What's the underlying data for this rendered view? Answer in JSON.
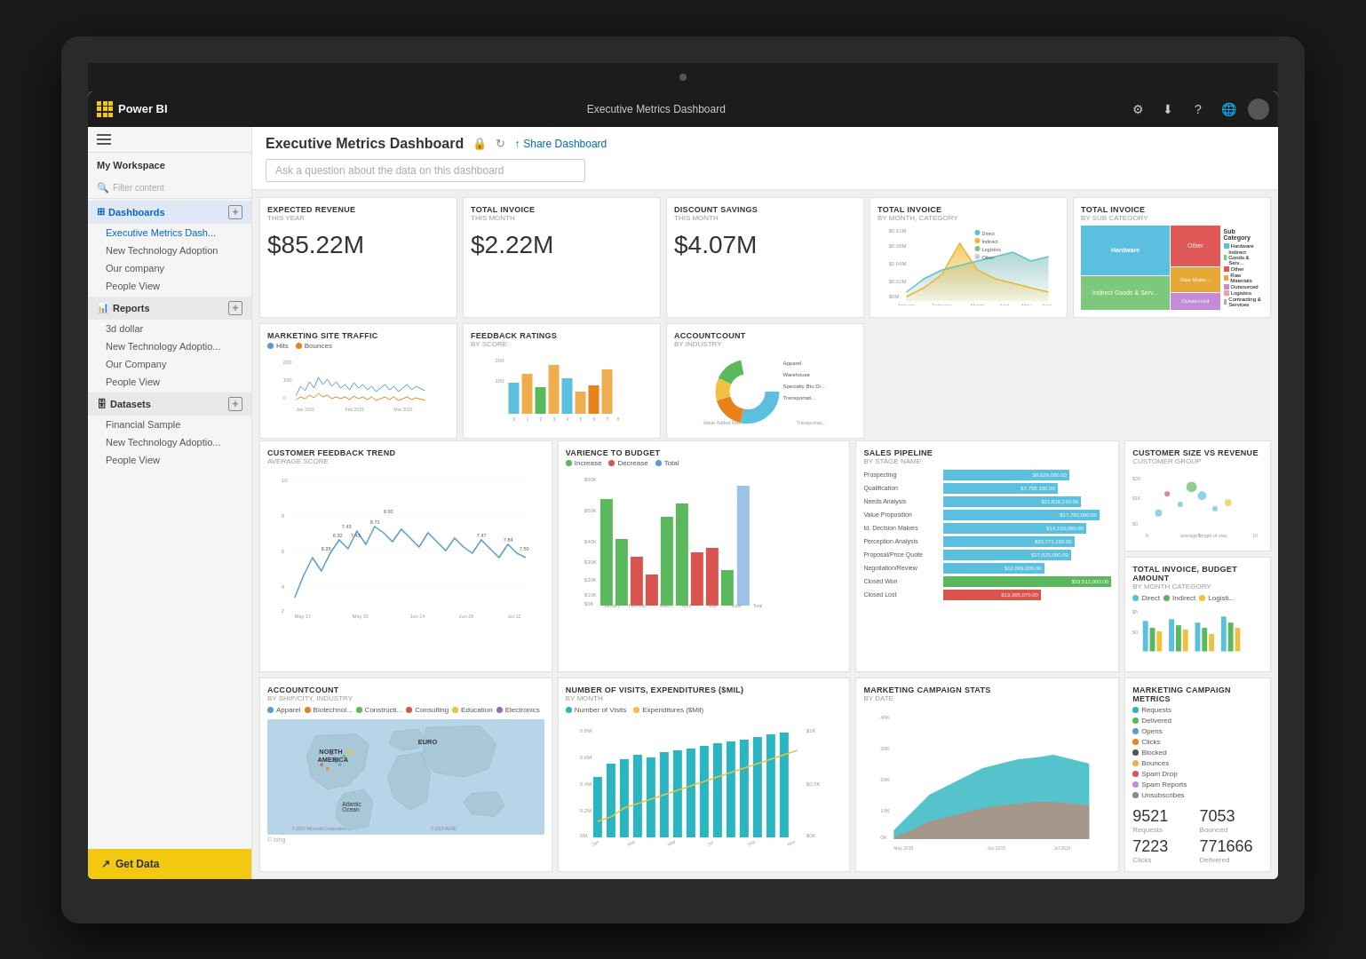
{
  "app": {
    "name": "Power BI",
    "header_title": "Executive Metrics Dashboard",
    "qa_placeholder": "Ask a question about the data on this dashboard"
  },
  "header_icons": {
    "settings": "⚙",
    "download": "⬇",
    "help": "?",
    "globe": "🌐"
  },
  "sidebar": {
    "workspace_label": "My Workspace",
    "filter_placeholder": "Filter content",
    "sections": [
      {
        "id": "dashboards",
        "label": "Dashboards",
        "items": [
          "Executive Metrics Dash...",
          "New Technology Adoption",
          "Our company",
          "People View"
        ]
      },
      {
        "id": "reports",
        "label": "Reports",
        "items": [
          "3d dollar",
          "New Technology Adoptio...",
          "Our Company",
          "People View"
        ]
      },
      {
        "id": "datasets",
        "label": "Datasets",
        "items": [
          "Financial Sample",
          "New Technology Adoptio...",
          "People View"
        ]
      }
    ],
    "get_data_label": "Get Data"
  },
  "dashboard": {
    "title": "Executive Metrics Dashboard",
    "share_label": "Share Dashboard",
    "tiles": {
      "expected_revenue": {
        "title": "Expected Revenue",
        "subtitle": "THIS YEAR",
        "value": "$85.22M"
      },
      "total_invoice_month": {
        "title": "Total Invoice",
        "subtitle": "THIS MONTH",
        "value": "$2.22M"
      },
      "discount_savings": {
        "title": "Discount Savings",
        "subtitle": "THIS MONTH",
        "value": "$4.07M"
      },
      "total_invoice_category": {
        "title": "Total Invoice",
        "subtitle": "BY MONTH, CATEGORY"
      },
      "total_invoice_subcategory": {
        "title": "Total Invoice",
        "subtitle": "BY SUB CATEGORY",
        "categories": [
          "Hardware",
          "Indirect Goods & Serv...",
          "Other",
          "Raw Materials",
          "Outsourced",
          "Logistics",
          "Contracting & Services"
        ]
      },
      "marketing_traffic": {
        "title": "Marketing Site Traffic",
        "legend": [
          "Hits",
          "Bounces"
        ]
      },
      "feedback_ratings": {
        "title": "Feedback Ratings",
        "subtitle": "BY SCORE"
      },
      "account_count": {
        "title": "AccountCount",
        "subtitle": "BY INDUSTRY"
      },
      "customer_feedback": {
        "title": "Customer Feedback Trend",
        "subtitle": "AVERAGE SCORE"
      },
      "variance_budget": {
        "title": "Varience to Budget",
        "legend": [
          "Increase",
          "Decrease",
          "Total"
        ]
      },
      "sales_pipeline": {
        "title": "Sales Pipeline",
        "subtitle": "BY STAGE NAME",
        "stages": [
          {
            "name": "Prospecting",
            "value": "$8,629,000.00",
            "color": "#5bc0de",
            "width": 75
          },
          {
            "name": "Qualification",
            "value": "$7,756,150.00",
            "color": "#5bc0de",
            "width": 68
          },
          {
            "name": "Needs Analysis",
            "value": "$11,819,210.00",
            "color": "#5bc0de",
            "width": 85
          },
          {
            "name": "Value Proposition",
            "value": "$17,782,080.00",
            "color": "#5bc0de",
            "width": 95
          },
          {
            "name": "Id. Decision Makers",
            "value": "$14,150,060.00",
            "color": "#5bc0de",
            "width": 88
          },
          {
            "name": "Perception Analysis",
            "value": "$20,771,190.00",
            "color": "#5bc0de",
            "width": 80
          },
          {
            "name": "Proposal/Price Quote",
            "value": "$17,025,000.00",
            "color": "#5bc0de",
            "width": 78
          },
          {
            "name": "Negotiation/Review",
            "value": "$12,609,200.00",
            "color": "#5bc0de",
            "width": 65
          },
          {
            "name": "Closed Won",
            "value": "$53,512,000.00",
            "color": "#5cb85c",
            "width": 100
          },
          {
            "name": "Closed Lost",
            "value": "$13,365,070.00",
            "color": "#d9534f",
            "width": 60
          }
        ]
      },
      "customer_size": {
        "title": "Customer Size vs Revenue",
        "subtitle": "CUSTOMER GROUP"
      },
      "total_invoice_budget": {
        "title": "Total Invoice, Budget Amount",
        "subtitle": "BY MONTH CATEGORY",
        "legend": [
          "Direct",
          "Indirect",
          "Logisti..."
        ]
      },
      "account_count_map": {
        "title": "AccountCount",
        "subtitle": "BY SHIP/CITY, INDUSTRY",
        "filters": [
          "Apparel",
          "Biotechnol...",
          "Constructi...",
          "Consulting",
          "Education",
          "Electronics"
        ]
      },
      "visits_expenditures": {
        "title": "Number of Visits, Expenditures ($Mil)",
        "subtitle": "BY MONTH",
        "legend": [
          "Number of Visits",
          "Expenditures ($Mil)"
        ]
      },
      "marketing_campaign": {
        "title": "Marketing Campaign Stats",
        "subtitle": "BY DATE"
      },
      "marketing_metrics": {
        "title": "Marketing Campaign Metrics",
        "stats": {
          "requests": "9521",
          "delivered": "7053",
          "clicks": "7223",
          "bounced_label": "Bounced",
          "delivered_label": "Delivered",
          "clicks_label": "Clicks",
          "unsubscribes": "771666"
        },
        "legend": [
          "Requests",
          "Delivered",
          "Opens",
          "Clicks",
          "Blocked",
          "Bounces",
          "Spam Drop",
          "Spam Reports",
          "Unsubscribes"
        ]
      }
    }
  }
}
